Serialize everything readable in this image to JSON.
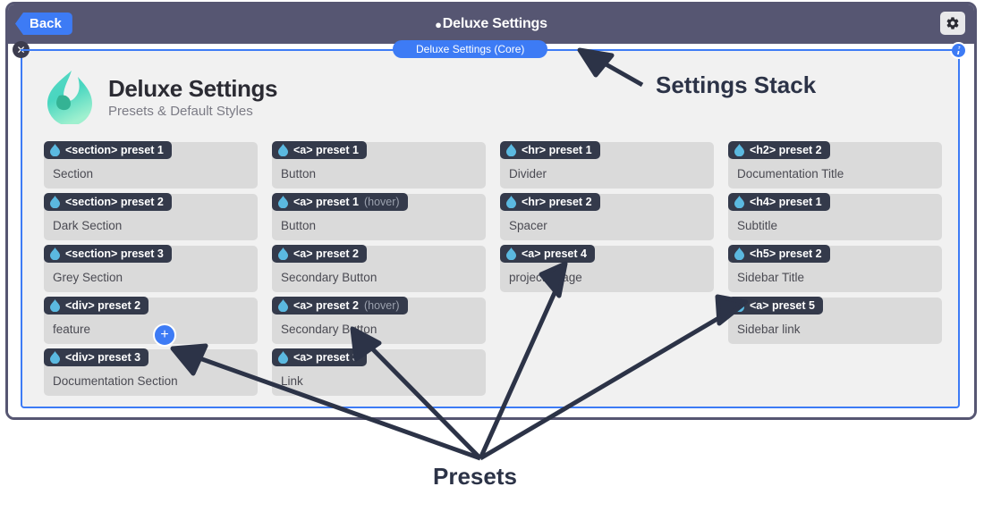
{
  "window": {
    "back_label": "Back",
    "title": "Deluxe Settings",
    "title_bullet": "●",
    "gear_icon": "gear-icon",
    "close_icon": "✕",
    "info_icon": "i"
  },
  "stack": {
    "pill_label": "Deluxe Settings (Core)"
  },
  "brand": {
    "name": "Deluxe Settings",
    "tagline": "Presets & Default Styles",
    "logo_icon": "droplet-logo-icon"
  },
  "add_button": {
    "label": "+"
  },
  "colors": {
    "accent_blue": "#3d7bf5",
    "titlebar": "#565672",
    "tab_dark": "#343a4b",
    "card_grey": "#dadada",
    "panel_grey": "#f1f1f1",
    "droplet_blue": "#5bb9e0",
    "logo_teal": "#3fd1b5"
  },
  "columns": [
    {
      "cards": [
        {
          "tag": "💧 <section> preset 1",
          "label": "<section> preset 1",
          "state": "",
          "body": "Section"
        },
        {
          "tag": "",
          "label": "<section> preset 2",
          "state": "",
          "body": "Dark Section"
        },
        {
          "tag": "",
          "label": "<section> preset 3",
          "state": "",
          "body": "Grey Section"
        },
        {
          "tag": "",
          "label": "<div> preset 2",
          "state": "",
          "body": "feature"
        },
        {
          "tag": "",
          "label": "<div> preset 3",
          "state": "",
          "body": "Documentation Section"
        }
      ]
    },
    {
      "cards": [
        {
          "label": "<a> preset 1",
          "state": "",
          "body": "Button"
        },
        {
          "label": "<a> preset 1",
          "state": "(hover)",
          "body": "Button"
        },
        {
          "label": "<a> preset 2",
          "state": "",
          "body": "Secondary Button"
        },
        {
          "label": "<a> preset 2",
          "state": "(hover)",
          "body": "Secondary Button"
        },
        {
          "label": "<a> preset 3",
          "state": "",
          "body": "Link"
        }
      ]
    },
    {
      "cards": [
        {
          "label": "<hr> preset 1",
          "state": "",
          "body": "Divider"
        },
        {
          "label": "<hr> preset 2",
          "state": "",
          "body": "Spacer"
        },
        {
          "label": "<a> preset 4",
          "state": "",
          "body": "project-image"
        }
      ]
    },
    {
      "cards": [
        {
          "label": "<h2> preset 2",
          "state": "",
          "body": "Documentation Title"
        },
        {
          "label": "<h4> preset 1",
          "state": "",
          "body": "Subtitle"
        },
        {
          "label": "<h5> preset 2",
          "state": "",
          "body": "Sidebar Title"
        },
        {
          "label": "<a> preset 5",
          "state": "",
          "body": "Sidebar link"
        }
      ]
    }
  ],
  "annotations": {
    "settings_stack": "Settings Stack",
    "presets": "Presets"
  }
}
